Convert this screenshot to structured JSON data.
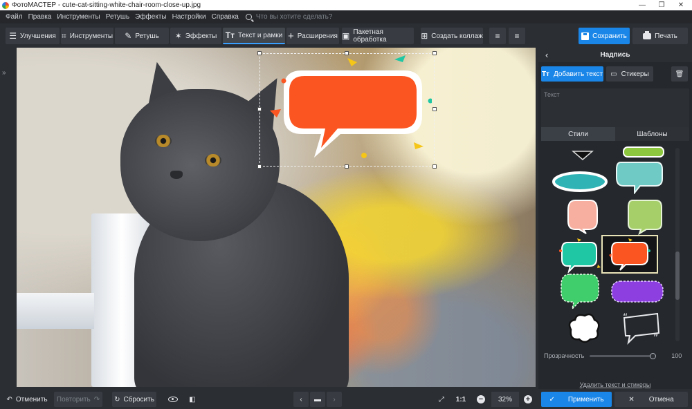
{
  "window": {
    "title": "ФотоМАСТЕР - cute-cat-sitting-white-chair-room-close-up.jpg",
    "controls": [
      "—",
      "❐",
      "✕"
    ]
  },
  "menu": {
    "items": [
      "Файл",
      "Правка",
      "Инструменты",
      "Ретушь",
      "Эффекты",
      "Настройки",
      "Справка"
    ],
    "search_placeholder": "Что вы хотите сделать?"
  },
  "toolbar": {
    "tabs": [
      {
        "label": "Улучшения",
        "icon": "sliders-icon"
      },
      {
        "label": "Инструменты",
        "icon": "crop-icon"
      },
      {
        "label": "Ретушь",
        "icon": "brush-icon"
      },
      {
        "label": "Эффекты",
        "icon": "magic-wand-icon"
      },
      {
        "label": "Текст и рамки",
        "icon": "text-icon"
      },
      {
        "label": "Расширения",
        "icon": "plus-icon"
      }
    ],
    "active_tab": "Текст и рамки",
    "batch_label": "Пакетная обработка",
    "collage_label": "Создать коллаж",
    "save_label": "Сохранить",
    "print_label": "Печать"
  },
  "panel": {
    "title": "Надпись",
    "add_text_label": "Добавить текст",
    "stickers_label": "Стикеры",
    "text_placeholder": "Текст",
    "tabs": [
      "Стили",
      "Шаблоны"
    ],
    "active_tab": "Стили",
    "opacity_label": "Прозрачность",
    "opacity_value": "100",
    "remove_link": "Удалить текст и стикеры"
  },
  "bottom": {
    "undo_label": "Отменить",
    "redo_label": "Повторить",
    "reset_label": "Сбросить",
    "ratio_label": "1:1",
    "zoom_value": "32%",
    "apply_label": "Применить",
    "cancel_label": "Отмена"
  },
  "colors": {
    "accent": "#1a86e8",
    "bubble_fill": "#fb5622",
    "background": "#2b2e33",
    "panel": "#25282c"
  }
}
